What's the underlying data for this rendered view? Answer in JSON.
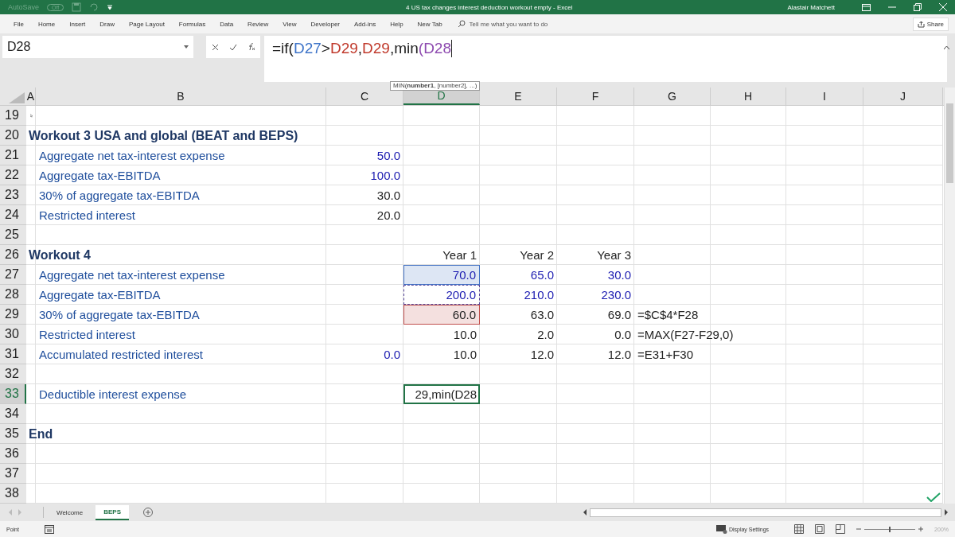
{
  "title_bar": {
    "autosave_label": "AutoSave",
    "autosave_state": "Off",
    "title": "4 US tax changes interest deduction workout empty  -  Excel",
    "user": "Alastair Matchett"
  },
  "menu_tabs": [
    "File",
    "Home",
    "Insert",
    "Draw",
    "Page Layout",
    "Formulas",
    "Data",
    "Review",
    "View",
    "Developer",
    "Add-ins",
    "Help",
    "New Tab"
  ],
  "tell_me": {
    "placeholder": "Tell me what you want to do"
  },
  "share": "Share",
  "name_box": "D28",
  "formula": [
    {
      "text": "=if(",
      "color": "#222222"
    },
    {
      "text": "D27",
      "color": "#3d73c8"
    },
    {
      "text": ">",
      "color": "#222222"
    },
    {
      "text": "D29",
      "color": "#c0392b"
    },
    {
      "text": ",",
      "color": "#222222"
    },
    {
      "text": "D29",
      "color": "#c0392b"
    },
    {
      "text": ",min",
      "color": "#222222"
    },
    {
      "text": "(D28",
      "color": "#8e4bb0"
    }
  ],
  "tooltip": "MIN(**number1**, [number2], ...)",
  "columns": [
    {
      "label": "A",
      "selected": false
    },
    {
      "label": "B",
      "selected": false
    },
    {
      "label": "C",
      "selected": false
    },
    {
      "label": "D",
      "selected": true
    },
    {
      "label": "E",
      "selected": false
    },
    {
      "label": "F",
      "selected": false
    },
    {
      "label": "G",
      "selected": false
    },
    {
      "label": "H",
      "selected": false
    },
    {
      "label": "I",
      "selected": false
    },
    {
      "label": "J",
      "selected": false
    }
  ],
  "rows": [
    {
      "num": "19",
      "selected": false,
      "pointer": true,
      "cells": {}
    },
    {
      "num": "20",
      "selected": false,
      "cells": {
        "A": {
          "text": "Workout 3 USA and global (BEAT and BEPS)",
          "kind": "heading"
        }
      }
    },
    {
      "num": "21",
      "selected": false,
      "cells": {
        "B": {
          "text": "Aggregate net tax-interest expense",
          "kind": "label"
        },
        "C": {
          "text": "50.0",
          "kind": "input"
        }
      }
    },
    {
      "num": "22",
      "selected": false,
      "cells": {
        "B": {
          "text": "Aggregate tax-EBITDA",
          "kind": "label"
        },
        "C": {
          "text": "100.0",
          "kind": "input"
        }
      }
    },
    {
      "num": "23",
      "selected": false,
      "cells": {
        "B": {
          "text": "30% of aggregate tax-EBITDA",
          "kind": "label"
        },
        "C": {
          "text": "30.0",
          "kind": "calc"
        }
      }
    },
    {
      "num": "24",
      "selected": false,
      "cells": {
        "B": {
          "text": "Restricted interest",
          "kind": "label"
        },
        "C": {
          "text": "20.0",
          "kind": "calc"
        }
      }
    },
    {
      "num": "25",
      "selected": false,
      "cells": {}
    },
    {
      "num": "26",
      "selected": false,
      "cells": {
        "A": {
          "text": "Workout 4",
          "kind": "heading"
        },
        "D": {
          "text": "Year 1",
          "kind": "calc"
        },
        "E": {
          "text": "Year 2",
          "kind": "calc"
        },
        "F": {
          "text": "Year 3",
          "kind": "calc"
        }
      }
    },
    {
      "num": "27",
      "selected": false,
      "cells": {
        "B": {
          "text": "Aggregate net tax-interest expense",
          "kind": "label"
        },
        "D": {
          "text": "70.0",
          "kind": "input",
          "color": "#4472c4",
          "dashed": false
        },
        "E": {
          "text": "65.0",
          "kind": "input"
        },
        "F": {
          "text": "30.0",
          "kind": "input"
        }
      }
    },
    {
      "num": "28",
      "selected": false,
      "cells": {
        "B": {
          "text": "Aggregate tax-EBITDA",
          "kind": "label"
        },
        "D": {
          "text": "200.0",
          "kind": "input",
          "color": "#5b4a9e",
          "dashed": true
        },
        "E": {
          "text": "210.0",
          "kind": "input"
        },
        "F": {
          "text": "230.0",
          "kind": "input"
        }
      }
    },
    {
      "num": "29",
      "selected": false,
      "cells": {
        "B": {
          "text": "30% of aggregate tax-EBITDA",
          "kind": "label"
        },
        "D": {
          "text": "60.0",
          "kind": "calc",
          "color": "#c0504d",
          "dashed": false
        },
        "E": {
          "text": "63.0",
          "kind": "calc"
        },
        "F": {
          "text": "69.0",
          "kind": "calc"
        },
        "G": {
          "text": "=$C$4*F28",
          "kind": "formula"
        }
      }
    },
    {
      "num": "30",
      "selected": false,
      "cells": {
        "B": {
          "text": "Restricted interest",
          "kind": "label"
        },
        "D": {
          "text": "10.0",
          "kind": "calc"
        },
        "E": {
          "text": "2.0",
          "kind": "calc"
        },
        "F": {
          "text": "0.0",
          "kind": "calc"
        },
        "G": {
          "text": "=MAX(F27-F29,0)",
          "kind": "formula"
        }
      }
    },
    {
      "num": "31",
      "selected": false,
      "cells": {
        "B": {
          "text": "Accumulated restricted interest",
          "kind": "label"
        },
        "C": {
          "text": "0.0",
          "kind": "input"
        },
        "D": {
          "text": "10.0",
          "kind": "calc"
        },
        "E": {
          "text": "12.0",
          "kind": "calc"
        },
        "F": {
          "text": "12.0",
          "kind": "calc"
        },
        "G": {
          "text": "=E31+F30",
          "kind": "formula"
        }
      }
    },
    {
      "num": "32",
      "selected": false,
      "cells": {}
    },
    {
      "num": "33",
      "selected": true,
      "cells": {
        "B": {
          "text": "Deductible interest expense",
          "kind": "label"
        },
        "D": {
          "text": "29,min(D28",
          "kind": "edit"
        }
      }
    },
    {
      "num": "34",
      "selected": false,
      "cells": {}
    },
    {
      "num": "35",
      "selected": false,
      "cells": {
        "A": {
          "text": "End",
          "kind": "heading"
        }
      }
    },
    {
      "num": "36",
      "selected": false,
      "cells": {}
    },
    {
      "num": "37",
      "selected": false,
      "cells": {}
    },
    {
      "num": "38",
      "selected": false,
      "cells": {}
    }
  ],
  "sheet_tabs": [
    {
      "label": "Welcome",
      "selected": false
    },
    {
      "label": "BEPS",
      "selected": true
    }
  ],
  "status_bar": {
    "mode": "Point",
    "display_settings": "Display Settings",
    "zoom_slider": {
      "level": 0.5
    },
    "zoom": "200%"
  }
}
